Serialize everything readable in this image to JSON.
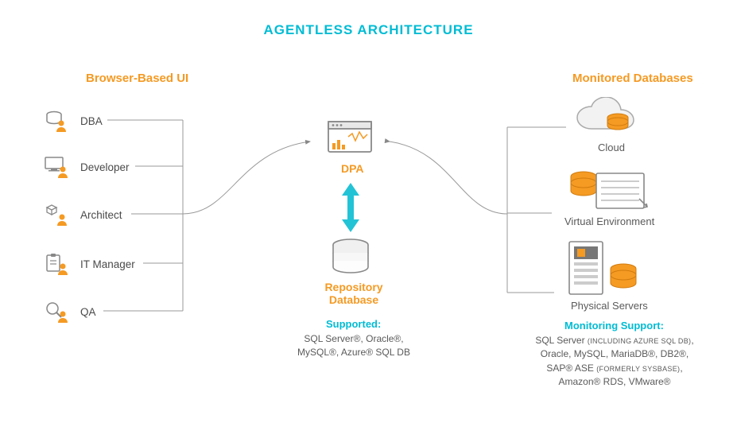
{
  "title": "AGENTLESS ARCHITECTURE",
  "left": {
    "heading": "Browser-Based UI",
    "roles": [
      "DBA",
      "Developer",
      "Architect",
      "IT Manager",
      "QA"
    ]
  },
  "center": {
    "dpa_label": "DPA",
    "repo_label": "Repository\nDatabase",
    "supported_heading": "Supported:",
    "supported_text": "SQL Server®, Oracle®,\nMySQL®, Azure® SQL DB"
  },
  "right": {
    "heading": "Monitored Databases",
    "nodes": [
      "Cloud",
      "Virtual Environment",
      "Physical Servers"
    ],
    "support_heading": "Monitoring Support:",
    "support_lines": [
      "SQL Server (INCLUDING AZURE SQL DB),",
      "Oracle, MySQL, MariaDB®, DB2®,",
      "SAP® ASE (FORMERLY SYSBASE),",
      "Amazon® RDS, VMware®"
    ]
  }
}
